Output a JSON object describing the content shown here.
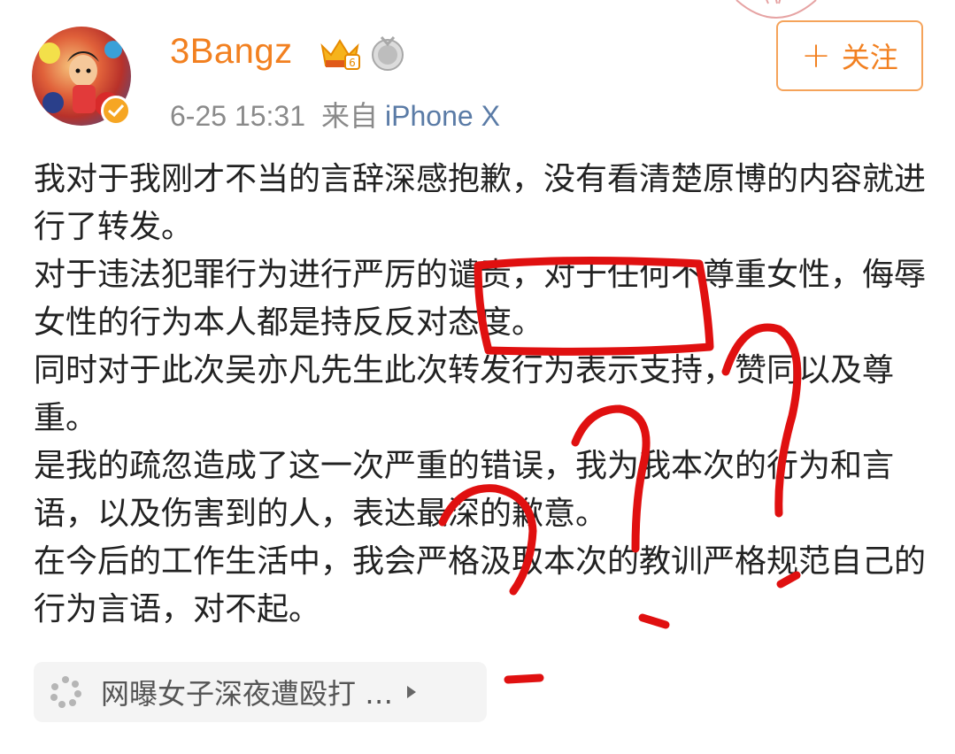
{
  "user": {
    "name": "3Bangz",
    "time": "6-25 15:31",
    "from_label": "来自",
    "device": "iPhone X"
  },
  "follow_button": {
    "plus": "+",
    "label": "关注"
  },
  "post": {
    "paragraphs": [
      "我对于我刚才不当的言辞深感抱歉，没有看清楚原博的内容就进行了转发。",
      "对于违法犯罪行为进行严厉的谴责，对于任何不尊重女性，侮辱女性的行为本人都是持反反对态度。",
      "同时对于此次吴亦凡先生此次转发行为表示支持，赞同以及尊重。",
      "是我的疏忽造成了这一次严重的错误，我为我本次的行为和言语，以及伤害到的人，表达最深的歉意。",
      "在今后的工作生活中，我会严格汲取本次的教训严格规范自己的行为言语，对不起。"
    ]
  },
  "topic": {
    "label": "网曝女子深夜遭殴打 …"
  },
  "icons": {
    "verified": "verified-badge-icon",
    "crown": "vip-crown-icon",
    "medal": "medal-icon",
    "topic": "topic-spinner-icon",
    "arrow": "play-arrow-icon"
  },
  "colors": {
    "username": "#f28020",
    "device_link": "#5a7ba6",
    "follow_border": "#f5a35a",
    "scribble": "#e01010"
  }
}
